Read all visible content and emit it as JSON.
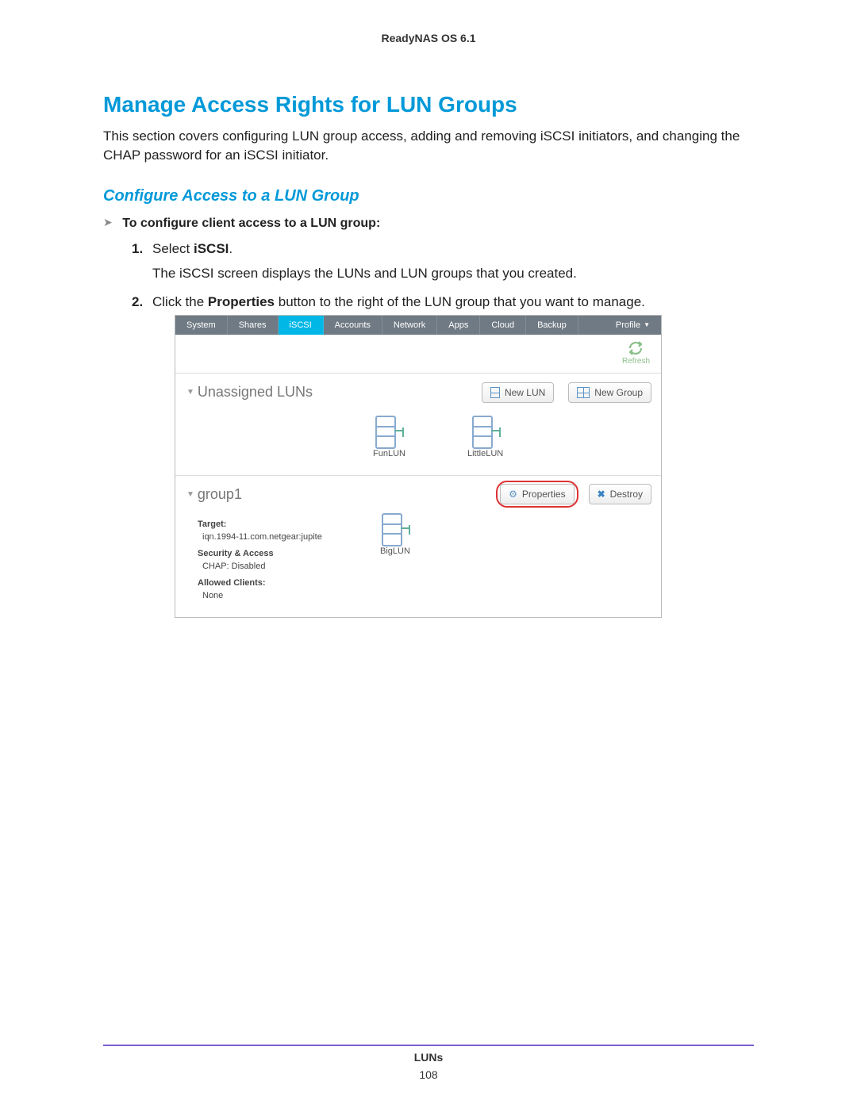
{
  "doc": {
    "product": "ReadyNAS OS 6.1",
    "section_title": "Manage Access Rights for LUN Groups",
    "lead": "This section covers configuring LUN group access, adding and removing iSCSI initiators, and changing the CHAP password for an iSCSI initiator.",
    "subsection": "Configure Access to a LUN Group",
    "proc_label": "To configure client access to a LUN group:",
    "steps": {
      "s1_num": "1.",
      "s1_pre": "Select ",
      "s1_bold": "iSCSI",
      "s1_post": ".",
      "s1_sub": "The iSCSI screen displays the LUNs and LUN groups that you created.",
      "s2_num": "2.",
      "s2_pre": "Click the ",
      "s2_bold": "Properties",
      "s2_post": " button to the right of the LUN group that you want to manage."
    },
    "footer_label": "LUNs",
    "page_number": "108"
  },
  "ui": {
    "tabs": {
      "system": "System",
      "shares": "Shares",
      "iscsi": "iSCSI",
      "accounts": "Accounts",
      "network": "Network",
      "apps": "Apps",
      "cloud": "Cloud",
      "backup": "Backup",
      "profile": "Profile"
    },
    "refresh": "Refresh",
    "unassigned": {
      "title": "Unassigned LUNs",
      "new_lun": "New LUN",
      "new_group": "New Group",
      "luns": {
        "fun": "FunLUN",
        "little": "LittleLUN"
      }
    },
    "group": {
      "name": "group1",
      "properties": "Properties",
      "destroy": "Destroy",
      "target_h": "Target:",
      "target_v": "iqn.1994-11.com.netgear:jupite",
      "sec_h": "Security & Access",
      "sec_v": "CHAP: Disabled",
      "clients_h": "Allowed Clients:",
      "clients_v": "None",
      "luns": {
        "big": "BigLUN"
      }
    }
  }
}
